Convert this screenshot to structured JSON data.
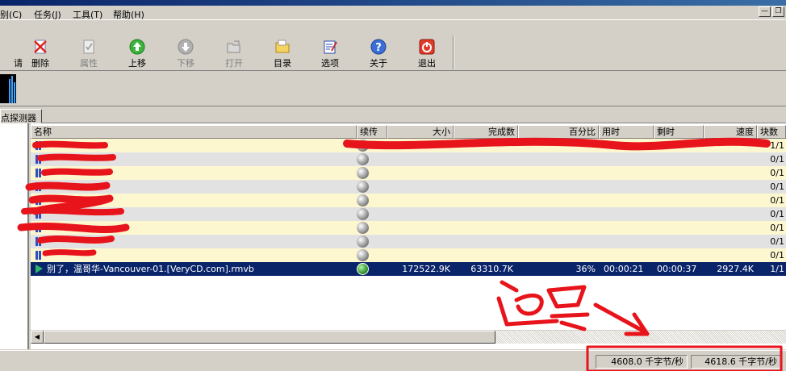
{
  "menu": {
    "items": [
      {
        "label": "别(C)"
      },
      {
        "label": "任务(J)"
      },
      {
        "label": "工具(T)"
      },
      {
        "label": "帮助(H)"
      }
    ]
  },
  "toolbar": {
    "buttons": [
      {
        "label": "删除",
        "icon": "delete-icon",
        "enabled": true
      },
      {
        "label": "属性",
        "icon": "properties-icon",
        "enabled": false
      },
      {
        "label": "上移",
        "icon": "move-up-icon",
        "enabled": true
      },
      {
        "label": "下移",
        "icon": "move-down-icon",
        "enabled": false
      },
      {
        "label": "打开",
        "icon": "open-icon",
        "enabled": false
      },
      {
        "label": "目录",
        "icon": "folder-icon",
        "enabled": true
      },
      {
        "label": "选项",
        "icon": "options-icon",
        "enabled": true
      },
      {
        "label": "关于",
        "icon": "about-icon",
        "enabled": true
      },
      {
        "label": "退出",
        "icon": "exit-icon",
        "enabled": true
      }
    ]
  },
  "tabs": {
    "active": "点探测器"
  },
  "columns": [
    "名称",
    "续传",
    "大小",
    "完成数",
    "百分比",
    "用时",
    "剩时",
    "速度",
    "块数"
  ],
  "rows": [
    {
      "name": "",
      "resume": "",
      "size": "",
      "done": "",
      "percent": "",
      "used": "",
      "left": "",
      "speed": "",
      "blocks": "1/1"
    },
    {
      "name": "",
      "resume": "",
      "size": "",
      "done": "",
      "percent": "",
      "used": "",
      "left": "",
      "speed": "",
      "blocks": "0/1"
    },
    {
      "name": "",
      "resume": "",
      "size": "",
      "done": "",
      "percent": "",
      "used": "",
      "left": "",
      "speed": "",
      "blocks": "0/1"
    },
    {
      "name": "",
      "resume": "",
      "size": "",
      "done": "",
      "percent": "",
      "used": "",
      "left": "",
      "speed": "",
      "blocks": "0/1"
    },
    {
      "name": "",
      "resume": "",
      "size": "",
      "done": "",
      "percent": "",
      "used": "",
      "left": "",
      "speed": "",
      "blocks": "0/1"
    },
    {
      "name": "",
      "resume": "",
      "size": "",
      "done": "",
      "percent": "",
      "used": "",
      "left": "",
      "speed": "",
      "blocks": "0/1"
    },
    {
      "name": "",
      "resume": "",
      "size": "",
      "done": "",
      "percent": "",
      "used": "",
      "left": "",
      "speed": "",
      "blocks": "0/1"
    },
    {
      "name": "",
      "resume": "",
      "size": "",
      "done": "",
      "percent": "",
      "used": "",
      "left": "",
      "speed": "",
      "blocks": "0/1"
    },
    {
      "name": "",
      "resume": "",
      "size": "",
      "done": "",
      "percent": "",
      "used": "",
      "left": "",
      "speed": "",
      "blocks": "0/1"
    },
    {
      "name": "别了，温哥华-Vancouver-01.[VeryCD.com].rmvb",
      "resume": "",
      "size": "172522.9K",
      "done": "63310.7K",
      "percent": "36%",
      "used": "00:00:21",
      "left": "00:00:37",
      "speed": "2927.4K",
      "blocks": "1/1"
    }
  ],
  "status": {
    "left_speed": "4608.0 千字节/秒",
    "right_speed": "4618.6 千字节/秒"
  },
  "colors": {
    "selection": "#0a246a",
    "row_odd": "#fdf7d0",
    "row_even": "#e2e2e2",
    "annotation_red": "#e8141b"
  }
}
